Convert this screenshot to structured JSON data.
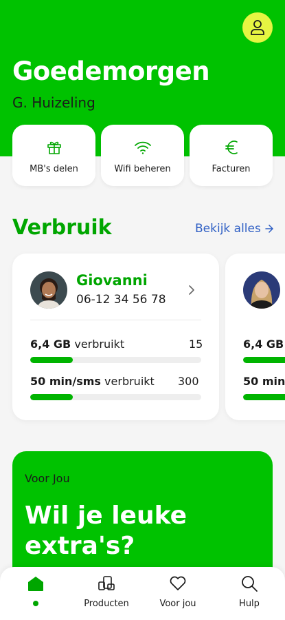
{
  "colors": {
    "brand_green": "#00c200",
    "accent_yellow": "#e6f542",
    "link_blue": "#2f5fc4"
  },
  "header": {
    "greeting": "Goedemorgen",
    "user_name": "G. Huizeling",
    "profile_icon": "user-icon"
  },
  "quick_actions": [
    {
      "label": "MB's delen",
      "icon": "gift-icon"
    },
    {
      "label": "Wifi beheren",
      "icon": "wifi-icon"
    },
    {
      "label": "Facturen",
      "icon": "euro-icon"
    }
  ],
  "usage": {
    "title": "Verbruik",
    "see_all": "Bekijk alles",
    "cards": [
      {
        "name": "Giovanni",
        "phone": "06-12 34 56 78",
        "data_amount": "6,4 GB",
        "data_suffix": "verbruikt",
        "data_limit": "15",
        "data_progress": 0.25,
        "calls_amount": "50 min/sms",
        "calls_suffix": "verbruikt",
        "calls_limit": "300",
        "calls_progress": 0.25
      },
      {
        "data_amount": "6,4 GB",
        "calls_amount": "50 min,"
      }
    ]
  },
  "promo": {
    "tag": "Voor Jou",
    "title": "Wil je leuke extra's?"
  },
  "nav": [
    {
      "label": "",
      "icon": "home-icon",
      "active": true
    },
    {
      "label": "Producten",
      "icon": "devices-icon"
    },
    {
      "label": "Voor jou",
      "icon": "heart-icon"
    },
    {
      "label": "Hulp",
      "icon": "search-icon"
    }
  ]
}
